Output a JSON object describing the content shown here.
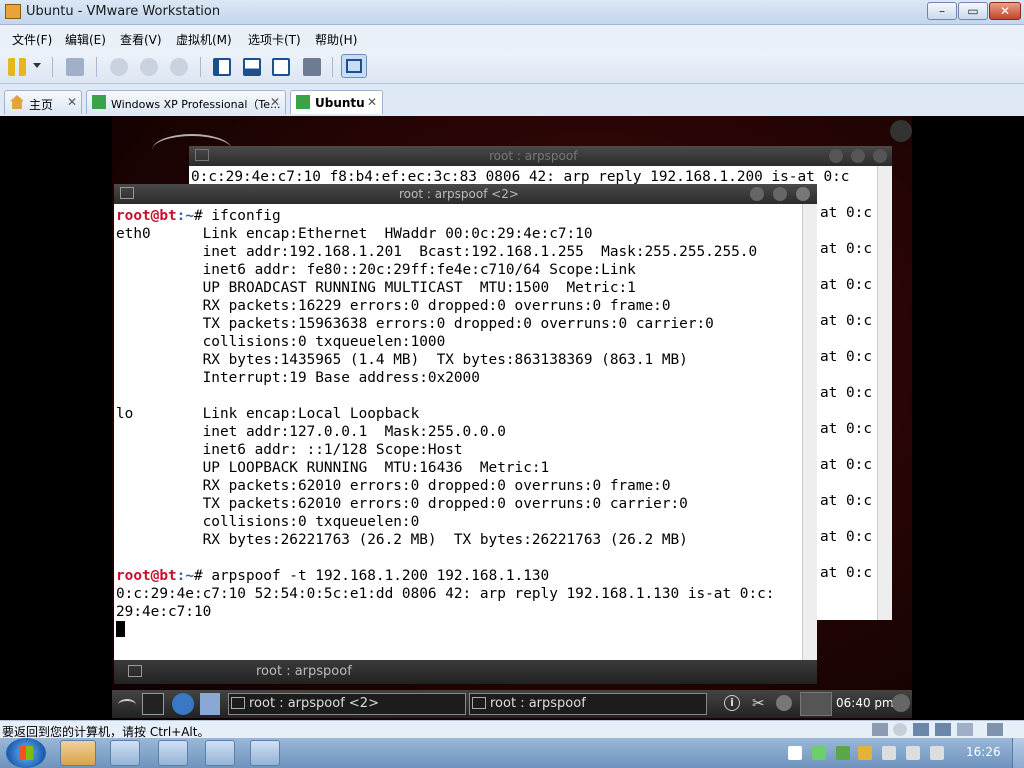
{
  "window": {
    "title": "Ubuntu - VMware Workstation",
    "minimize": "–",
    "maximize": "▭",
    "close": "✕"
  },
  "menu": [
    "文件(F)",
    "编辑(E)",
    "查看(V)",
    "虚拟机(M)",
    "选项卡(T)",
    "帮助(H)"
  ],
  "tabs": [
    {
      "label": "主页",
      "close": "✕",
      "active": false
    },
    {
      "label": "Windows XP Professional（Te...",
      "close": "✕",
      "active": false
    },
    {
      "label": "Ubuntu",
      "close": "✕",
      "active": true
    }
  ],
  "back_terminal": {
    "title": "root : arpspoof",
    "first_line": "0:c:29:4e:c7:10 f8:b4:ef:ec:3c:83 0806 42: arp reply 192.168.1.200 is-at 0:c",
    "repeat_text": "at 0:c"
  },
  "front_terminal": {
    "title": "root : arpspoof <2>",
    "prompt_user": "root@bt",
    "prompt_path": ":~",
    "prompt_symbol": "#",
    "cmd1": " ifconfig",
    "lines": [
      "eth0      Link encap:Ethernet  HWaddr 00:0c:29:4e:c7:10",
      "          inet addr:192.168.1.201  Bcast:192.168.1.255  Mask:255.255.255.0",
      "          inet6 addr: fe80::20c:29ff:fe4e:c710/64 Scope:Link",
      "          UP BROADCAST RUNNING MULTICAST  MTU:1500  Metric:1",
      "          RX packets:16229 errors:0 dropped:0 overruns:0 frame:0",
      "          TX packets:15963638 errors:0 dropped:0 overruns:0 carrier:0",
      "          collisions:0 txqueuelen:1000",
      "          RX bytes:1435965 (1.4 MB)  TX bytes:863138369 (863.1 MB)",
      "          Interrupt:19 Base address:0x2000",
      "",
      "lo        Link encap:Local Loopback",
      "          inet addr:127.0.0.1  Mask:255.0.0.0",
      "          inet6 addr: ::1/128 Scope:Host",
      "          UP LOOPBACK RUNNING  MTU:16436  Metric:1",
      "          RX packets:62010 errors:0 dropped:0 overruns:0 frame:0",
      "          TX packets:62010 errors:0 dropped:0 overruns:0 carrier:0",
      "          collisions:0 txqueuelen:0",
      "          RX bytes:26221763 (26.2 MB)  TX bytes:26221763 (26.2 MB)",
      ""
    ],
    "cmd2": " arpspoof -t 192.168.1.200 192.168.1.130",
    "out1": "0:c:29:4e:c7:10 52:54:0:5c:e1:dd 0806 42: arp reply 192.168.1.130 is-at 0:c:",
    "out2": "29:4e:c7:10"
  },
  "minimized_window": {
    "title": "root : arpspoof"
  },
  "guest_panel": {
    "task1": "root : arpspoof <2>",
    "task2": "root : arpspoof",
    "clock": "06:40 pm"
  },
  "status": {
    "hint": "要返回到您的计算机，请按 Ctrl+Alt。"
  },
  "taskbar": {
    "clock": "16:26"
  },
  "colors": {
    "prompt_user": "#c8102e",
    "prompt_path": "#3465a4",
    "accent": "#3a6ea5"
  }
}
